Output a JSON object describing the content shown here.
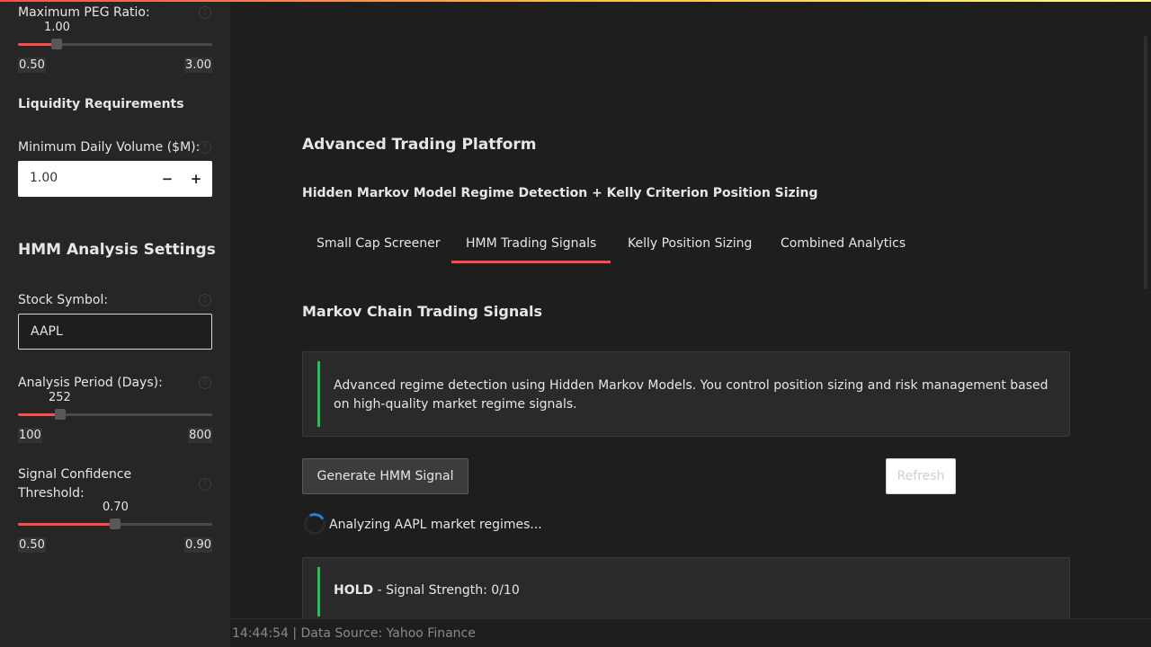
{
  "sidebar": {
    "peg": {
      "label": "Maximum PEG Ratio:",
      "value": "1.00",
      "fraction": 0.2,
      "min": "0.50",
      "max": "3.00"
    },
    "liquidity_heading": "Liquidity Requirements",
    "volume": {
      "label": "Minimum Daily Volume ($M):",
      "value": "1.00",
      "minus": "−",
      "plus": "+"
    },
    "hmm_heading": "HMM Analysis Settings",
    "symbol": {
      "label": "Stock Symbol:",
      "value": "AAPL"
    },
    "period": {
      "label": "Analysis Period (Days):",
      "value": "252",
      "fraction": 0.217,
      "min": "100",
      "max": "800"
    },
    "confidence": {
      "label_line1": "Signal Confidence",
      "label_line2": "Threshold:",
      "value": "0.70",
      "fraction": 0.5,
      "min": "0.50",
      "max": "0.90"
    },
    "help_glyph": "?"
  },
  "main": {
    "title": "Advanced Trading Platform",
    "subtitle": "Hidden Markov Model Regime Detection + Kelly Criterion Position Sizing",
    "tabs": [
      {
        "label": "Small Cap Screener",
        "active": false
      },
      {
        "label": "HMM Trading Signals",
        "active": true
      },
      {
        "label": "Kelly Position Sizing",
        "active": false
      },
      {
        "label": "Combined Analytics",
        "active": false
      }
    ],
    "section_title": "Markov Chain Trading Signals",
    "info_text": "Advanced regime detection using Hidden Markov Models. You control position sizing and risk management based on high-quality market regime signals.",
    "generate_button": "Generate HMM Signal",
    "refresh_button": "Refresh",
    "spinner_text": "Analyzing AAPL market regimes...",
    "signal": {
      "action": "HOLD",
      "rest": " - Signal Strength: 0/10"
    },
    "footer": "14:44:54 | Data Source: Yahoo Finance"
  },
  "colors": {
    "accent": "#ff4b4b",
    "success": "#21c354",
    "spinner": "#1c83e1"
  }
}
